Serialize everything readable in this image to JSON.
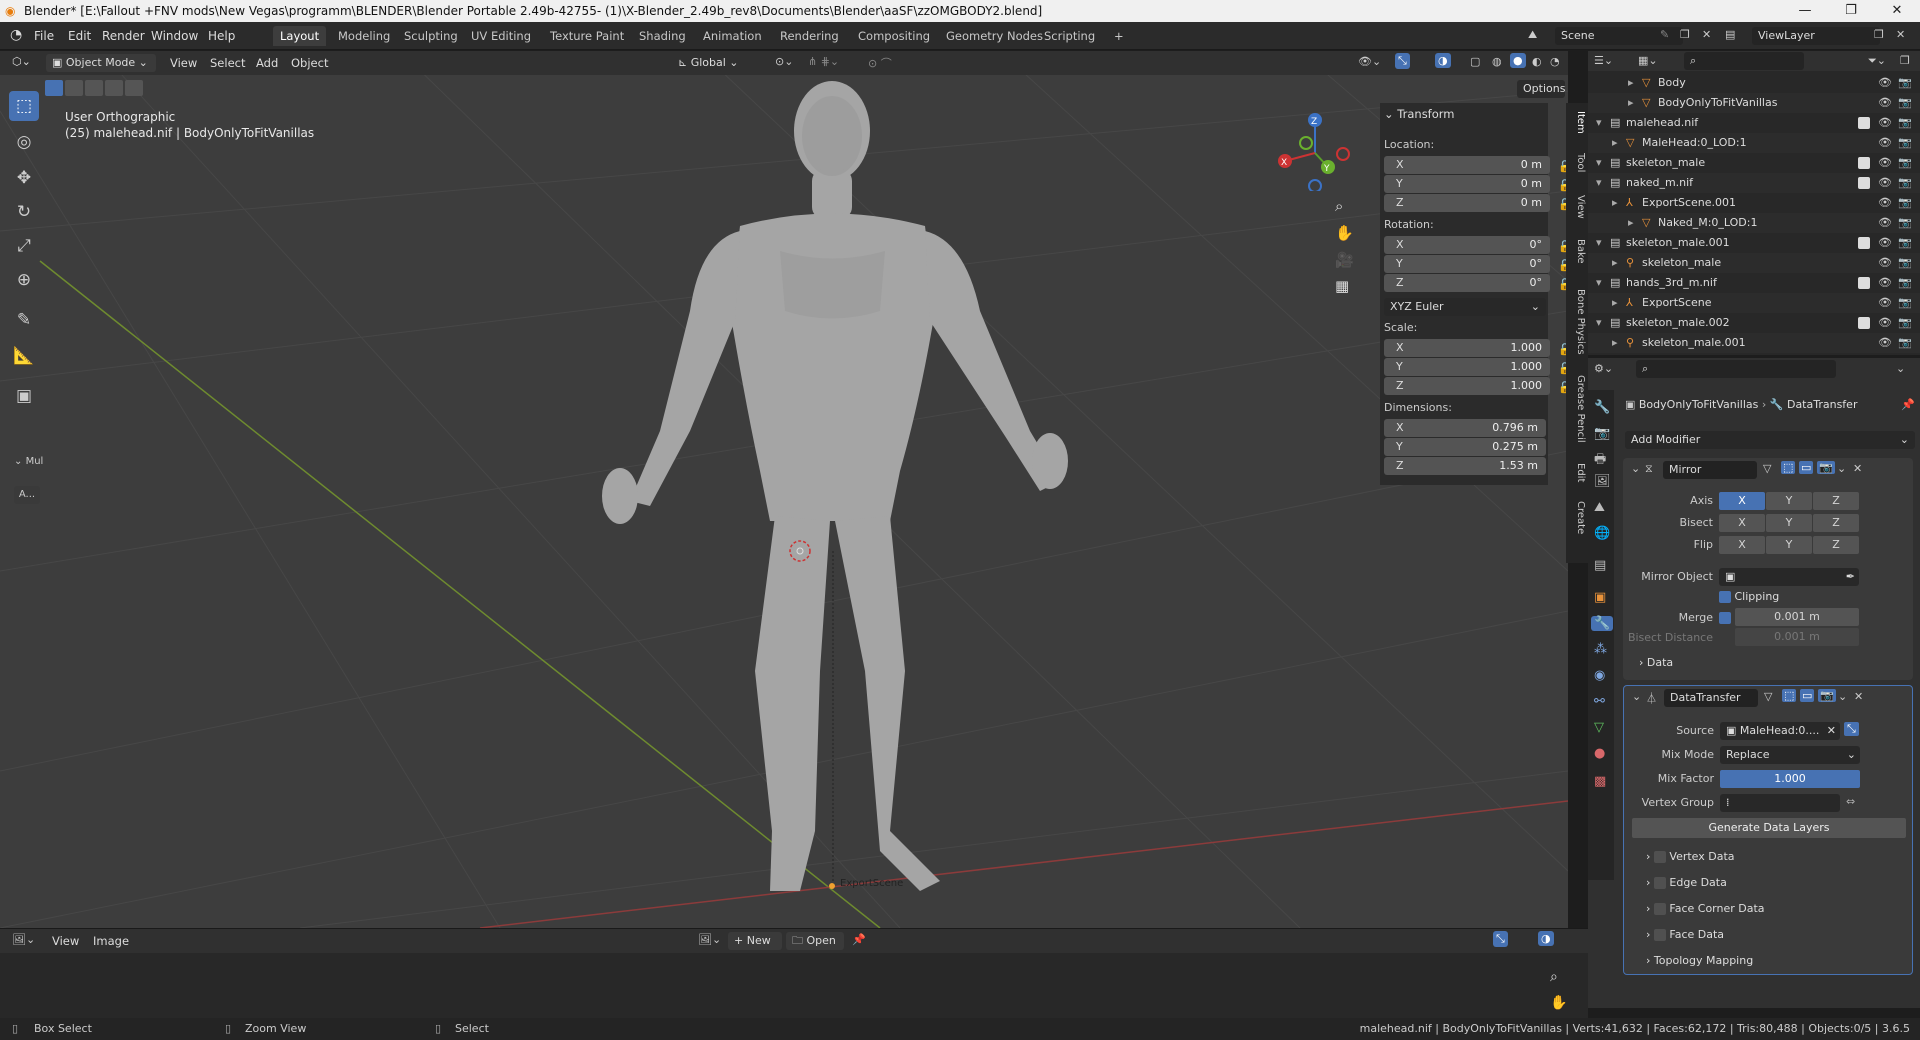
{
  "window": {
    "title": "Blender* [E:\\Fallout +FNV mods\\New Vegas\\programm\\BLENDER\\Blender Portable 2.49b-42755- (1)\\X-Blender_2.49b_rev8\\Documents\\Blender\\aaSF\\zzOMGBODY2.blend]",
    "minimize": "—",
    "maximize": "❐",
    "close": "✕"
  },
  "menu": [
    "File",
    "Edit",
    "Render",
    "Window",
    "Help"
  ],
  "workspaces": [
    "Layout",
    "Modeling",
    "Sculpting",
    "UV Editing",
    "Texture Paint",
    "Shading",
    "Animation",
    "Rendering",
    "Compositing",
    "Geometry Nodes",
    "Scripting",
    "+"
  ],
  "scene": {
    "name": "Scene",
    "view_layer": "ViewLayer"
  },
  "viewport_header": {
    "mode": "Object Mode",
    "menus": [
      "View",
      "Select",
      "Add",
      "Object"
    ],
    "transform_orientation": "Global",
    "options": "Options"
  },
  "viewport": {
    "view_name": "User Orthographic",
    "object_info": "(25) malehead.nif | BodyOnlyToFitVanillas",
    "origin_label": "ExportScene",
    "side_labels": [
      "Mul",
      "A..."
    ]
  },
  "sidebar_tabs": [
    "Item",
    "Tool",
    "View",
    "Bake",
    "Bone Physics",
    "Grease Pencil",
    "Edit",
    "Create"
  ],
  "transform": {
    "header": "Transform",
    "location_label": "Location:",
    "location": [
      {
        "axis": "X",
        "value": "0 m"
      },
      {
        "axis": "Y",
        "value": "0 m"
      },
      {
        "axis": "Z",
        "value": "0 m"
      }
    ],
    "rotation_label": "Rotation:",
    "rotation": [
      {
        "axis": "X",
        "value": "0°"
      },
      {
        "axis": "Y",
        "value": "0°"
      },
      {
        "axis": "Z",
        "value": "0°"
      }
    ],
    "rotation_mode": "XYZ Euler",
    "scale_label": "Scale:",
    "scale": [
      {
        "axis": "X",
        "value": "1.000"
      },
      {
        "axis": "Y",
        "value": "1.000"
      },
      {
        "axis": "Z",
        "value": "1.000"
      }
    ],
    "dimensions_label": "Dimensions:",
    "dimensions": [
      {
        "axis": "X",
        "value": "0.796 m"
      },
      {
        "axis": "Y",
        "value": "0.275 m"
      },
      {
        "axis": "Z",
        "value": "1.53 m"
      }
    ]
  },
  "outliner": [
    {
      "name": "Body",
      "depth": 2
    },
    {
      "name": "BodyOnlyToFitVanillas",
      "depth": 2
    },
    {
      "name": "malehead.nif",
      "depth": 0
    },
    {
      "name": "MaleHead:0_LOD:1",
      "depth": 1
    },
    {
      "name": "skeleton_male",
      "depth": 0
    },
    {
      "name": "naked_m.nif",
      "depth": 0
    },
    {
      "name": "ExportScene.001",
      "depth": 1
    },
    {
      "name": "Naked_M:0_LOD:1",
      "depth": 2
    },
    {
      "name": "skeleton_male.001",
      "depth": 0
    },
    {
      "name": "skeleton_male",
      "depth": 1
    },
    {
      "name": "hands_3rd_m.nif",
      "depth": 0
    },
    {
      "name": "ExportScene",
      "depth": 1
    },
    {
      "name": "skeleton_male.002",
      "depth": 0
    },
    {
      "name": "skeleton_male.001",
      "depth": 1
    }
  ],
  "properties": {
    "breadcrumb_object": "BodyOnlyToFitVanillas",
    "breadcrumb_modifier": "DataTransfer",
    "add_modifier": "Add Modifier",
    "mirror": {
      "name": "Mirror",
      "axis_label": "Axis",
      "bisect_label": "Bisect",
      "flip_label": "Flip",
      "axes": [
        "X",
        "Y",
        "Z"
      ],
      "mirror_object_label": "Mirror Object",
      "clipping_label": "Clipping",
      "merge_label": "Merge",
      "merge_value": "0.001 m",
      "bisect_distance_label": "Bisect Distance",
      "bisect_distance_value": "0.001 m",
      "data_label": "Data"
    },
    "datatransfer": {
      "name": "DataTransfer",
      "source_label": "Source",
      "source_value": "MaleHead:0....",
      "mix_mode_label": "Mix Mode",
      "mix_mode_value": "Replace",
      "mix_factor_label": "Mix Factor",
      "mix_factor_value": "1.000",
      "vertex_group_label": "Vertex Group",
      "generate_button": "Generate Data Layers",
      "sections": [
        "Vertex Data",
        "Edge Data",
        "Face Corner Data",
        "Face Data"
      ],
      "topology": "Topology Mapping"
    }
  },
  "image_editor": {
    "menus": [
      "View",
      "Image"
    ],
    "new_label": "New",
    "open_label": "Open"
  },
  "statusbar": {
    "box_select": "Box Select",
    "zoom_view": "Zoom View",
    "select": "Select",
    "stats": "malehead.nif | BodyOnlyToFitVanillas | Verts:41,632 | Faces:62,172 | Tris:80,488 | Objects:0/5 | 3.6.5"
  }
}
